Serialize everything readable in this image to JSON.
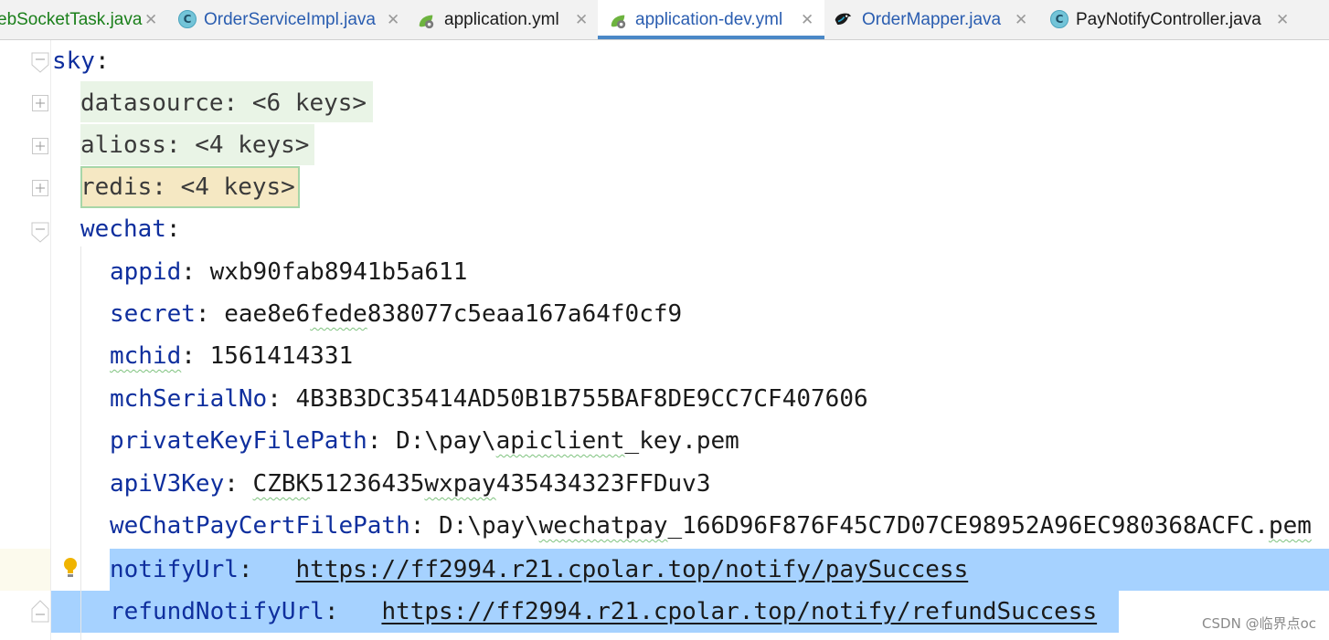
{
  "tabs": [
    {
      "label": "ebSocketTask.java",
      "icon": "class-icon",
      "color": "#1a7f1a"
    },
    {
      "label": "OrderServiceImpl.java",
      "icon": "class-icon",
      "color": "#2a5db0"
    },
    {
      "label": "application.yml",
      "icon": "spring-yaml-icon",
      "color": "#1a1a1a"
    },
    {
      "label": "application-dev.yml",
      "icon": "spring-yaml-icon",
      "color": "#2a5db0",
      "active": true
    },
    {
      "label": "OrderMapper.java",
      "icon": "mybatis-bird-icon",
      "color": "#2a5db0"
    },
    {
      "label": "PayNotifyController.java",
      "icon": "class-icon",
      "color": "#1a1a1a"
    }
  ],
  "tab_close_glyph": "✕",
  "class_icon_letter": "C",
  "editor": {
    "sky": {
      "key": "sky",
      "colon": ":"
    },
    "folded": [
      {
        "key": "datasource",
        "summary": "<6 keys>"
      },
      {
        "key": "alioss",
        "summary": "<4 keys>"
      },
      {
        "key": "redis",
        "summary": "<4 keys>"
      }
    ],
    "wechat": {
      "key": "wechat",
      "colon": ":"
    },
    "entries": {
      "appid": {
        "key": "appid",
        "value": "wxb90fab8941b5a611"
      },
      "secret": {
        "key": "secret",
        "value_a": "eae8e6",
        "value_b": "fede",
        "value_c": "838077c5eaa167a64f0cf9"
      },
      "mchid": {
        "key": "mchid",
        "value": "1561414331"
      },
      "mchSerialNo": {
        "key": "mchSerialNo",
        "value": "4B3B3DC35414AD50B1B755BAF8DE9CC7CF407606"
      },
      "privateKeyFilePath": {
        "key": "privateKeyFilePath",
        "value_a": "D:\\pay\\",
        "value_b": "apiclient",
        "value_c": "_key.pem"
      },
      "apiV3Key": {
        "key": "apiV3Key",
        "value_a": "CZBK",
        "value_b": "51236435",
        "value_c": "wxpay",
        "value_d": "435434323FFDuv3"
      },
      "weChatPayCertFilePath": {
        "key": "weChatPayCertFilePath",
        "value_a": "D:\\pay\\",
        "value_b": "wechatpay",
        "value_c": "_166D96F876F45C7D07CE98952A96EC980368ACFC.",
        "value_d": "pem"
      },
      "notifyUrl": {
        "key": "notifyUrl",
        "value": "https://ff2994.r21.cpolar.top/notify/paySuccess"
      },
      "refundNotifyUrl": {
        "key": "refundNotifyUrl",
        "value": "https://ff2994.r21.cpolar.top/notify/refundSuccess"
      }
    }
  },
  "watermark": "CSDN @临界点oc",
  "colors": {
    "key": "#0f2f9e",
    "selection": "#a6d2ff",
    "folded_region": "#e9f4e6",
    "folded_selected": "#f5e8c3",
    "tab_underline": "#4a88c7",
    "bulb": "#f0b400"
  }
}
